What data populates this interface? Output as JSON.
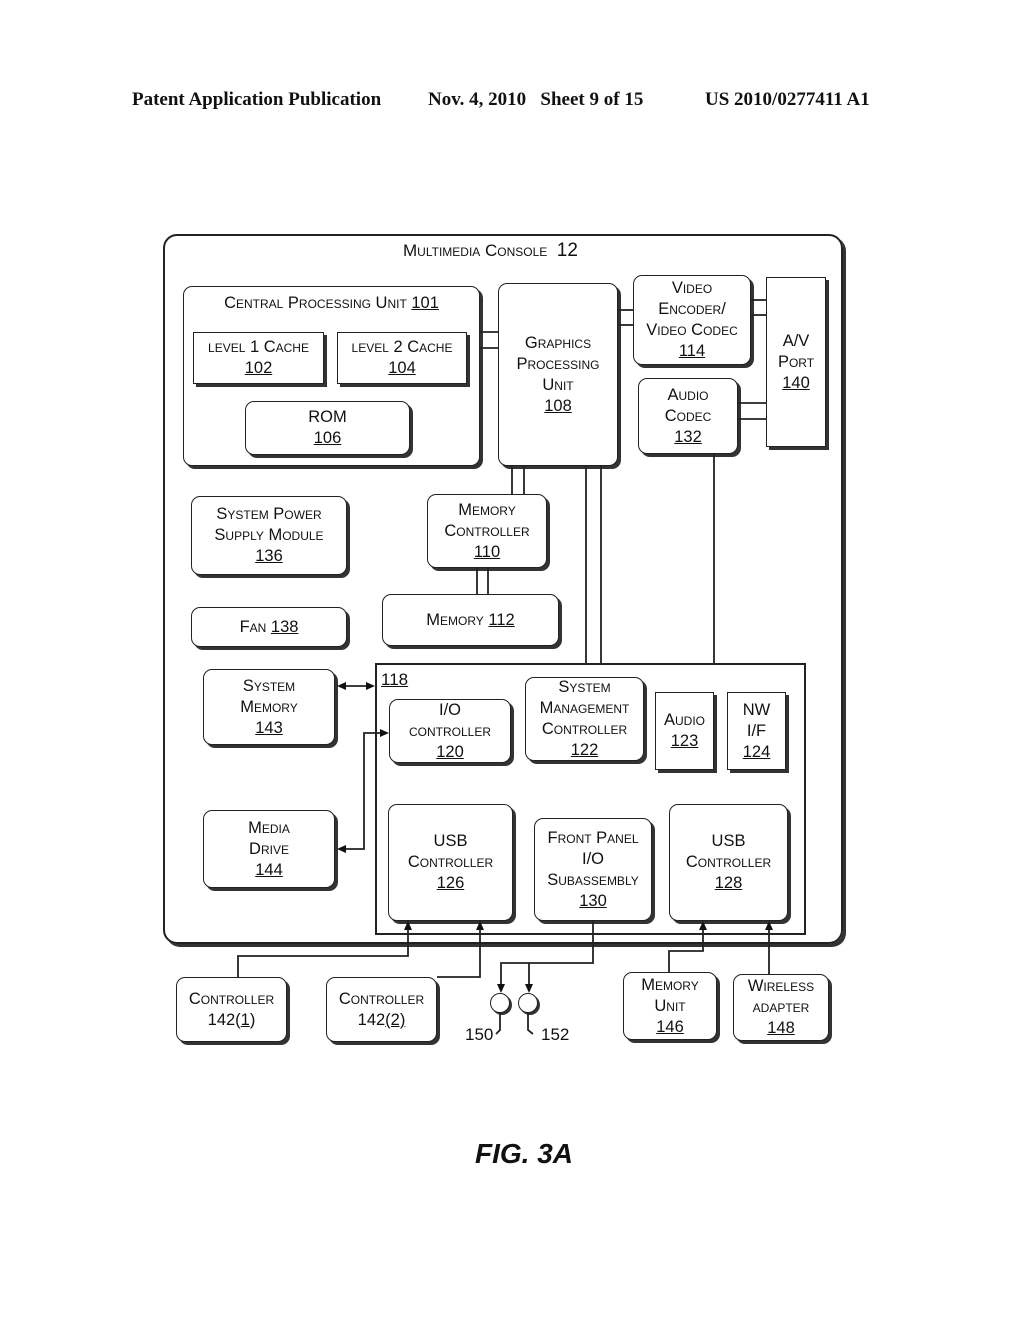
{
  "header": {
    "left": "Patent Application Publication",
    "date_sheet": "Nov. 4, 2010   Sheet 9 of 15",
    "number": "US 2010/0277411 A1"
  },
  "figure_label": "FIG. 3A",
  "console": {
    "title": "Multimedia Console",
    "ref": "12"
  },
  "cpu": {
    "title": "Central Processing Unit",
    "ref": "101"
  },
  "blocks": {
    "l1": {
      "lines": [
        "level 1 Cache"
      ],
      "ref": "102"
    },
    "l2": {
      "lines": [
        "level 2 Cache"
      ],
      "ref": "104"
    },
    "rom": {
      "lines": [
        "ROM"
      ],
      "ref": "106"
    },
    "gpu": {
      "lines": [
        "Graphics",
        "Processing",
        "Unit"
      ],
      "ref": "108"
    },
    "video": {
      "lines": [
        "Video",
        "Encoder/",
        "Video Codec"
      ],
      "ref": "114"
    },
    "audio_codec": {
      "lines": [
        "Audio",
        "Codec"
      ],
      "ref": "132"
    },
    "av_port": {
      "lines": [
        "A/V",
        "Port"
      ],
      "ref": "140"
    },
    "power": {
      "lines": [
        "System Power",
        "Supply Module"
      ],
      "ref": "136"
    },
    "mem_ctrl": {
      "lines": [
        "Memory",
        "Controller"
      ],
      "ref": "110"
    },
    "memory": {
      "text": "Memory",
      "ref": "112"
    },
    "fan": {
      "text": "Fan",
      "ref": "138"
    },
    "sys_mem": {
      "lines": [
        "System",
        "Memory"
      ],
      "ref": "143"
    },
    "media_drive": {
      "lines": [
        "Media",
        "Drive"
      ],
      "ref": "144"
    },
    "io_ctrl": {
      "lines": [
        "I/O",
        "controller"
      ],
      "ref": "120"
    },
    "smc": {
      "lines": [
        "System",
        "Management",
        "Controller"
      ],
      "ref": "122"
    },
    "audio": {
      "lines": [
        "Audio"
      ],
      "ref": "123"
    },
    "nw": {
      "lines": [
        "NW",
        "I/F"
      ],
      "ref": "124"
    },
    "usb1": {
      "lines": [
        "USB",
        "Controller"
      ],
      "ref": "126"
    },
    "front_panel": {
      "lines": [
        "Front Panel",
        "I/O",
        "Subassembly"
      ],
      "ref": "130"
    },
    "usb2": {
      "lines": [
        "USB",
        "Controller"
      ],
      "ref": "128"
    },
    "ctrl1": {
      "lines": [
        "Controller"
      ],
      "prefix": "142(",
      "ref": "1",
      "suffix": ")"
    },
    "ctrl2": {
      "lines": [
        "Controller"
      ],
      "prefix": "142",
      "ref": "(2)",
      "suffix": ""
    },
    "mem_unit": {
      "lines": [
        "Memory",
        "Unit"
      ],
      "ref": "146"
    },
    "wireless": {
      "lines": [
        "Wireless",
        "adapter"
      ],
      "ref": "148"
    }
  },
  "hub_ref": "118",
  "ports": {
    "p150": "150",
    "p152": "152"
  }
}
